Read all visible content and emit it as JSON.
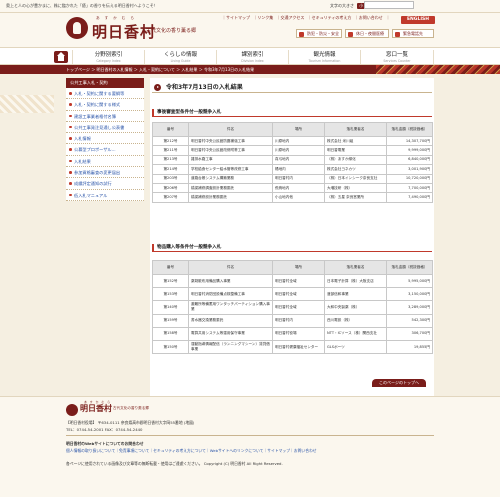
{
  "top": {
    "welcome": "奥上と人の心が豊かまに、株に臨かれた「癒」の香りを伝える明日香村へようこそ！",
    "font_size_label": "文字の大きさ",
    "font_size_small": "小",
    "font_size_large": "大",
    "search_placeholder": "",
    "search_button": "検索"
  },
  "header": {
    "logo_ruby": "あすかむら",
    "logo_text": "明日香村",
    "tagline": "古代文化の香り薫る郷",
    "util_links": [
      "｜サイトマップ",
      "｜リンク集",
      "｜交通アクセス",
      "｜セキュリティの考え方",
      "｜お問い合わせ",
      "｜"
    ],
    "english": "ENGLISH",
    "sub_buttons": [
      "防犯・防災・安全",
      "休日・夜間医療",
      "緊急電話先"
    ]
  },
  "gnav": [
    {
      "title": "分野別索引",
      "sub": "Category Index"
    },
    {
      "title": "くらしの情報",
      "sub": "Living Guide"
    },
    {
      "title": "課別索引",
      "sub": "Division Index"
    },
    {
      "title": "観光情報",
      "sub": "Tourism Information"
    },
    {
      "title": "窓口一覧",
      "sub": "Services Counter"
    }
  ],
  "breadcrumb": "トップページ ＞ 明日香村の入札情報 ＞ 入札・契約について ＞ 入札結果 ＞ 令和3年7月13日の入札結果",
  "sidebar": {
    "title": "公共工事入札・契約",
    "items": [
      "入札・契約に関する要綱等",
      "入札・契約に関する様式",
      "建設工事業者格付名簿",
      "公共工事発注見通し公表書",
      "入札情報",
      "公募型プロポーザル...",
      "入札結果",
      "参加資格審査の変更届出",
      "成績評定通知の試行",
      "低入札マニュアル"
    ]
  },
  "main": {
    "title": "令和3年7月13日の入札結果",
    "section1": {
      "heading": "事後審査型条件付一般競争入札",
      "headers": [
        "番号",
        "件名",
        "場所",
        "落札業者名",
        "落札金額（税抜価格）"
      ],
      "rows": [
        [
          "第212号",
          "明日香村中央公民館防震補強工事",
          "川原地内",
          "株式会社 米川組",
          "14,307,700円"
        ],
        [
          "第211号",
          "明日香村中央公民館改修附帯工事",
          "川原地内",
          "明日香電業",
          "9,999,000円"
        ],
        [
          "第213号",
          "雑排水路工事",
          "真弓地内",
          "（株）あすか緑化",
          "6,840,000円"
        ],
        [
          "第214号",
          "学校給食センター給水管等改修工事",
          "橘地内",
          "株式会社ヨネカツ",
          "3,001,900円"
        ],
        [
          "第203号",
          "道路台帳システム構築業務",
          "明日香村内",
          "（株）日本インシーク奈良支社",
          "10,720,000円"
        ],
        [
          "第206号",
          "橋梁補修調査設計業務委託",
          "飛鳥地内",
          "大増技研（株）",
          "7,700,000円"
        ],
        [
          "第207号",
          "橋梁補修設計業務委託",
          "小山地内他",
          "（株）五星 奈良営業所",
          "7,490,000円"
        ]
      ]
    },
    "section2": {
      "heading": "物品購入等条件付一般競争入札",
      "headers": [
        "番号",
        "件名",
        "場所",
        "落札業者名",
        "落札金額（税抜価格）"
      ],
      "rows": [
        [
          "第152号",
          "薬剤散布用備品購入事業",
          "明日香村全域",
          "日本電子計算（株）大阪支店",
          "5,995,000円"
        ],
        [
          "第153号",
          "明日香村消防団設備点検整備工事",
          "明日香村全域",
          "渡部信和事業",
          "3,150,000円"
        ],
        [
          "第140号",
          "避難所等備蓄用ワンタッチパーティション購入事業",
          "明日香村全域",
          "大和中央製薬（株）",
          "3,289,000円"
        ],
        [
          "第159号",
          "書水器交換業務委託",
          "明日香村内",
          "西川電設（株）",
          "542,300円"
        ],
        [
          "第158号",
          "電算共用システム等運用保守事業",
          "明日香村役場",
          "NTT・ICソース（株）関西支社",
          "306,700円"
        ],
        [
          "第150号",
          "運動指導情報配信（ランニングマシーン）賃貸借事業",
          "明日香村健康福祉センター",
          "GLSポーツ",
          "19,855円"
        ]
      ]
    },
    "back": "このページのトップへ"
  },
  "footer": {
    "logo_ruby": "あすかむら",
    "logo_text": "明日香村",
    "tagline": "古代文化の香り薫る郷",
    "address": "【明日香村役場】 〒634-0111 奈良県高市郡明日香村大字岡55番地 (地図)",
    "phone": "TEL：0744-54-2001   FAX：0744-54-2440",
    "about_title": "明日香村のWebサイトについてのお問合わせ",
    "about_links": "個人情報の取り扱いについて｜免責事項について｜セキュリティの考え方について｜Webサイトへのリンクについて｜サイトマップ｜お問い合わせ",
    "copyright": "各ページに使用されている画像及び文章等の無断転載・使用はご遠慮ください。 Copyright (C) 明日香村 All Right Reserved."
  }
}
